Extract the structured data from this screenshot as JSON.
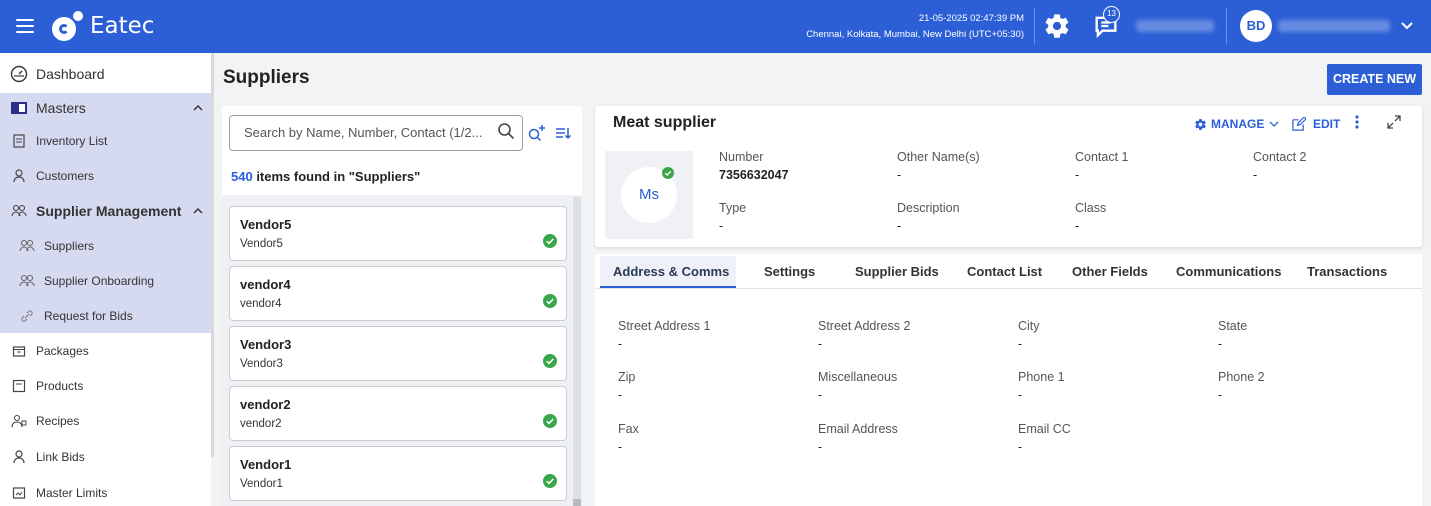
{
  "app": {
    "brand": "Eatec",
    "datetime": "21-05-2025 02:47:39 PM",
    "timezone": "Chennai, Kolkata, Mumbai, New Delhi (UTC+05:30)",
    "notification_count": "13",
    "user_initials": "BD",
    "accent_color": "#2c5fd6",
    "success_color": "#3aa64a"
  },
  "sidebar": {
    "items": [
      {
        "label": "Dashboard",
        "icon": "dashboard-icon"
      },
      {
        "label": "Masters",
        "icon": "masters-icon",
        "expanded": true
      },
      {
        "label": "Inventory List",
        "icon": "inventory-icon"
      },
      {
        "label": "Customers",
        "icon": "person-icon"
      },
      {
        "label": "Supplier Management",
        "icon": "supplier-management-icon",
        "expanded": true
      },
      {
        "label": "Suppliers",
        "icon": "suppliers-icon"
      },
      {
        "label": "Supplier Onboarding",
        "icon": "onboarding-icon"
      },
      {
        "label": "Request for Bids",
        "icon": "link-icon"
      },
      {
        "label": "Packages",
        "icon": "package-icon"
      },
      {
        "label": "Products",
        "icon": "product-icon"
      },
      {
        "label": "Recipes",
        "icon": "recipe-icon"
      },
      {
        "label": "Link Bids",
        "icon": "person-icon"
      },
      {
        "label": "Master Limits",
        "icon": "limits-icon"
      }
    ]
  },
  "main": {
    "title": "Suppliers",
    "create_label": "CREATE NEW",
    "search_placeholder": "Search by Name, Number, Contact (1/2...",
    "count": "540",
    "count_suffix": " items found in \"Suppliers\"",
    "vendors": [
      {
        "name": "Vendor5",
        "sub": "Vendor5"
      },
      {
        "name": "vendor4",
        "sub": "vendor4"
      },
      {
        "name": "Vendor3",
        "sub": "Vendor3"
      },
      {
        "name": "vendor2",
        "sub": "vendor2"
      },
      {
        "name": "Vendor1",
        "sub": "Vendor1"
      }
    ]
  },
  "detail": {
    "title": "Meat supplier",
    "manage_label": "MANAGE",
    "edit_label": "EDIT",
    "avatar_text": "Ms",
    "fields": [
      {
        "label": "Number",
        "value": "7356632047"
      },
      {
        "label": "Other Name(s)",
        "value": "-"
      },
      {
        "label": "Contact 1",
        "value": "-"
      },
      {
        "label": "Contact 2",
        "value": "-"
      },
      {
        "label": "Type",
        "value": "-"
      },
      {
        "label": "Description",
        "value": "-"
      },
      {
        "label": "Class",
        "value": "-"
      }
    ],
    "tabs": [
      "Address & Comms",
      "Settings",
      "Supplier Bids",
      "Contact List",
      "Other Fields",
      "Communications",
      "Transactions"
    ],
    "address_fields": [
      {
        "label": "Street Address 1",
        "value": "-"
      },
      {
        "label": "Street Address 2",
        "value": "-"
      },
      {
        "label": "City",
        "value": "-"
      },
      {
        "label": "State",
        "value": "-"
      },
      {
        "label": "Zip",
        "value": "-"
      },
      {
        "label": "Miscellaneous",
        "value": "-"
      },
      {
        "label": "Phone 1",
        "value": "-"
      },
      {
        "label": "Phone 2",
        "value": "-"
      },
      {
        "label": "Fax",
        "value": "-"
      },
      {
        "label": "Email Address",
        "value": "-"
      },
      {
        "label": "Email CC",
        "value": "-"
      }
    ]
  }
}
